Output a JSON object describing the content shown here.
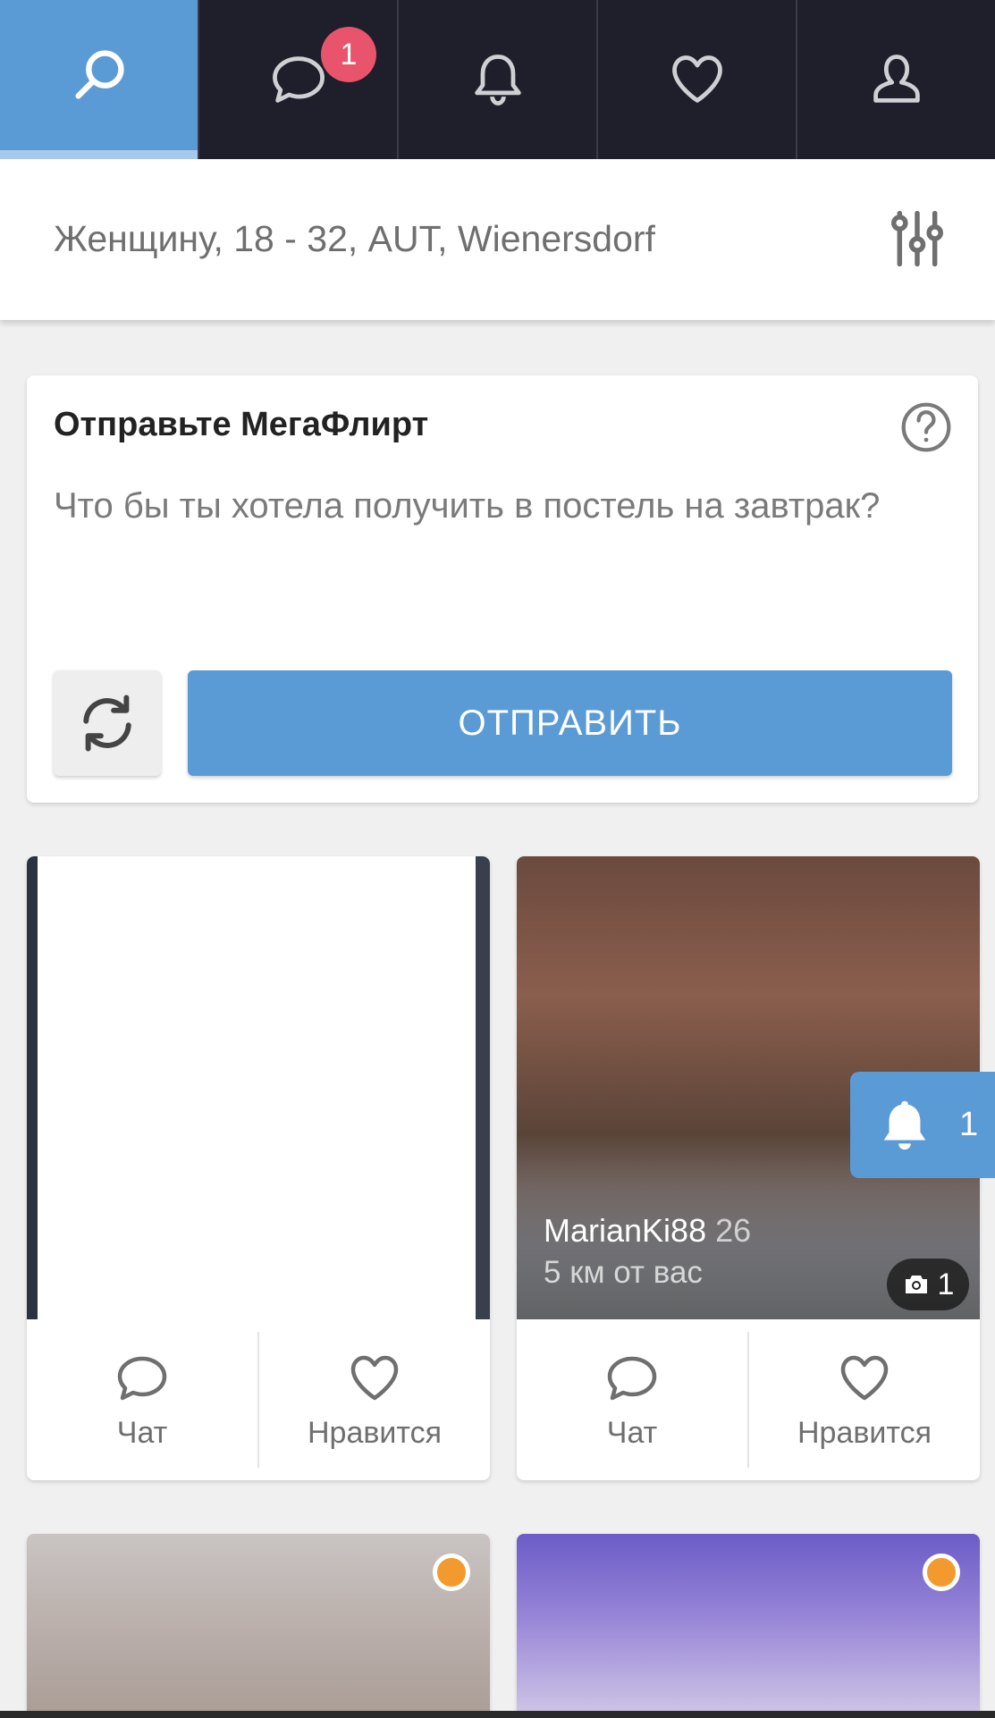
{
  "nav": {
    "tabs": [
      {
        "name": "search",
        "icon": "search-icon"
      },
      {
        "name": "messages",
        "icon": "chat-bubble-icon",
        "badge": "1"
      },
      {
        "name": "notifications",
        "icon": "bell-icon"
      },
      {
        "name": "likes",
        "icon": "heart-icon"
      },
      {
        "name": "profile",
        "icon": "user-icon"
      }
    ],
    "active_color": "#5b9bd5",
    "badge_color": "#e8546b"
  },
  "filter": {
    "text": "Женщину, 18 - 32, AUT, Wienersdorf",
    "icon": "sliders-icon"
  },
  "megaflirt": {
    "title": "Отправьте МегаФлирт",
    "question": "Что бы ты хотела получить в постель на завтрак?",
    "send_label": "ОТПРАВИТЬ",
    "refresh_icon": "refresh-icon",
    "help_icon": "help-icon"
  },
  "profiles": [
    {
      "name": "",
      "age": "",
      "distance": "",
      "chat_label": "Чат",
      "like_label": "Нравится"
    },
    {
      "name": "MarianKi88",
      "age": "26",
      "distance": "5 км от вас",
      "photo_count": "1",
      "chat_label": "Чат",
      "like_label": "Нравится"
    },
    {
      "online": true
    },
    {
      "online": true
    }
  ],
  "floating_notification": {
    "count": "1",
    "icon": "bell-icon"
  }
}
